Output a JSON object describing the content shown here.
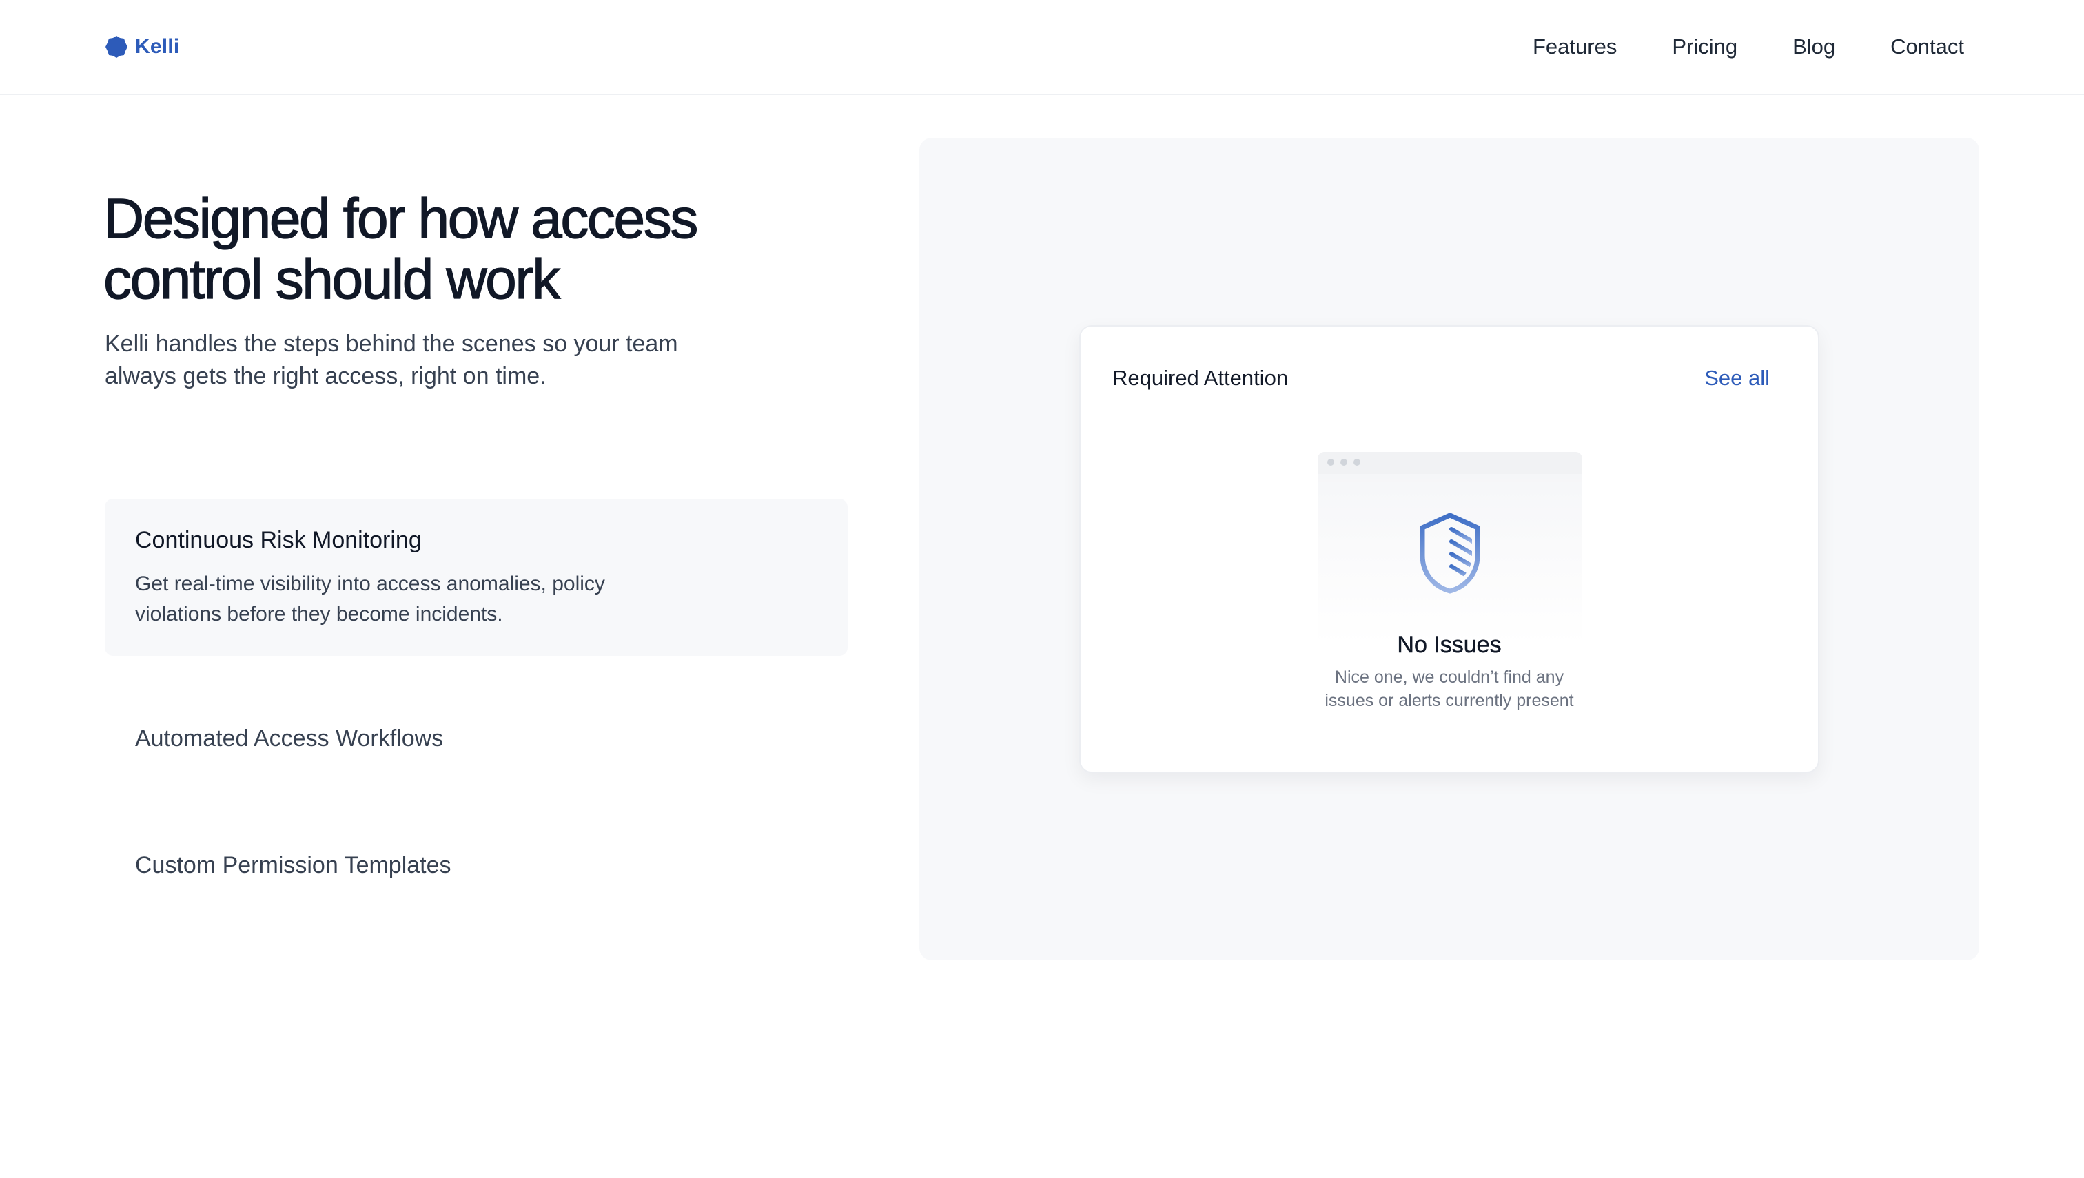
{
  "header": {
    "brand_name": "Kelli",
    "brand_icon": "hexagon-logo-icon",
    "brand_color": "#2d5bb9",
    "nav": [
      "Features",
      "Pricing",
      "Blog",
      "Contact"
    ]
  },
  "hero": {
    "title": "Designed for how access control should work",
    "subtitle": "Kelli handles the steps behind the scenes so your team always gets the right access, right on time."
  },
  "features": {
    "active": {
      "title": "Continuous Risk Monitoring",
      "description": "Get real-time visibility into access anomalies, policy violations before they become incidents."
    },
    "items": [
      "Automated Access Workflows",
      "Custom Permission Templates"
    ]
  },
  "preview": {
    "card_title": "Required Attention",
    "card_link": "See all",
    "empty_icon": "shield-icon",
    "empty_title": "No Issues",
    "empty_description": "Nice one, we couldn’t find any issues or alerts currently present"
  },
  "colors": {
    "accent": "#2d5bb9",
    "panel_bg": "#f7f8fa",
    "text_primary": "#111827",
    "text_secondary": "#374151",
    "text_muted": "#6b7280"
  }
}
